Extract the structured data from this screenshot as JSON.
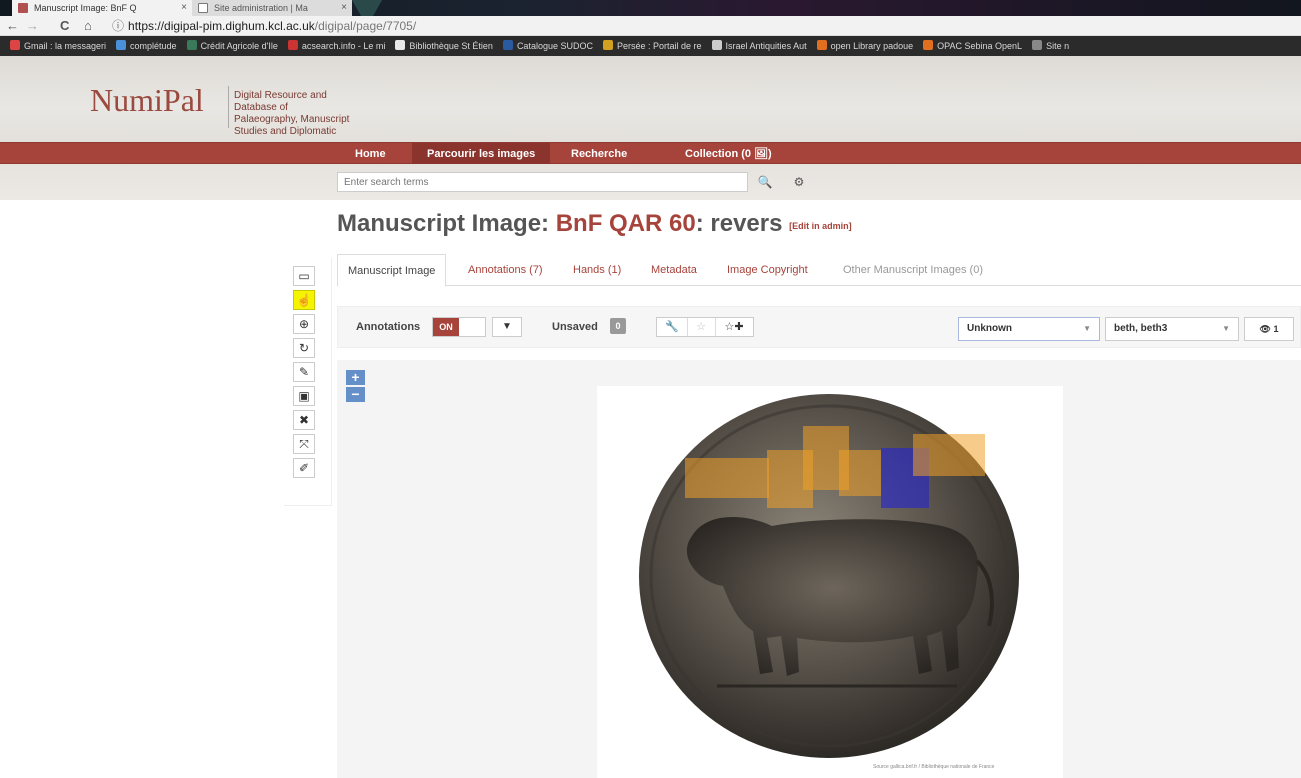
{
  "browser": {
    "tabs": [
      {
        "title": "Manuscript Image: BnF Q",
        "active": true
      },
      {
        "title": "Site administration | Ma",
        "active": false
      }
    ],
    "tab_close": "×",
    "url_host": "https://digipal-pim.dighum.kcl.ac.uk",
    "url_path": "/digipal/page/7705/",
    "nav_back": "←",
    "nav_forward": "→",
    "nav_reload": "C",
    "nav_home": "⌂",
    "info_icon": "ⓘ",
    "bookmarks": [
      {
        "label": "Gmail : la messageri",
        "color": "#d44"
      },
      {
        "label": "complétude",
        "color": "#4a90d9"
      },
      {
        "label": "Crédit Agricole d'Ile",
        "color": "#3a7a5a"
      },
      {
        "label": "acsearch.info - Le mi",
        "color": "#c33"
      },
      {
        "label": "Bibliothèque St Étien",
        "color": "#e8e8e8"
      },
      {
        "label": "Catalogue SUDOC",
        "color": "#2a5aa0"
      },
      {
        "label": "Persée : Portail de re",
        "color": "#d0a020"
      },
      {
        "label": "Israel Antiquities Aut",
        "color": "#ccc"
      },
      {
        "label": "open Library padoue",
        "color": "#e07020"
      },
      {
        "label": "OPAC Sebina OpenL",
        "color": "#e07020"
      },
      {
        "label": "Site n",
        "color": "#888"
      }
    ]
  },
  "site": {
    "logo": "NumiPal",
    "tagline": "Digital Resource and Database of Palaeography, Manuscript Studies and Diplomatic",
    "accent": "#a6433b",
    "nav": [
      {
        "label": "Home",
        "active": false
      },
      {
        "label": "Parcourir les images",
        "active": true
      },
      {
        "label": "Recherche",
        "active": false
      },
      {
        "label": "Collection (0 🖼)",
        "active": false
      }
    ],
    "search_placeholder": "Enter search terms",
    "search_icon": "🔍",
    "gear_icon": "⚙"
  },
  "page": {
    "title_prefix": "Manuscript Image: ",
    "title_ms": "BnF QAR 60",
    "title_suffix": ": revers",
    "edit_link": "[Edit in admin]"
  },
  "tabs": [
    {
      "label": "Manuscript Image",
      "state": "active"
    },
    {
      "label": "Annotations (7)",
      "state": "normal"
    },
    {
      "label": "Hands (1)",
      "state": "normal"
    },
    {
      "label": "Metadata",
      "state": "normal"
    },
    {
      "label": "Image Copyright",
      "state": "normal"
    },
    {
      "label": "Other Manuscript Images (0)",
      "state": "disabled"
    }
  ],
  "toolbar": {
    "annotations_label": "Annotations",
    "toggle_on": "ON",
    "filter_icon": "▼",
    "unsaved_label": "Unsaved",
    "unsaved_count": "0",
    "wrench_icon": "🔧",
    "star_icon": "☆",
    "star_add_icon": "☆✚",
    "allograph_select": "Unknown",
    "letters_select": "beth, beth3",
    "caret": "▼",
    "eye_count": "👁 1"
  },
  "tools": [
    {
      "name": "monitor-icon",
      "glyph": "▭",
      "selected": false
    },
    {
      "name": "hand-pointer-icon",
      "glyph": "☝",
      "selected": true
    },
    {
      "name": "zoom-in-icon",
      "glyph": "⊕",
      "selected": false
    },
    {
      "name": "refresh-icon",
      "glyph": "↻",
      "selected": false
    },
    {
      "name": "pencil-icon",
      "glyph": "✎",
      "selected": false
    },
    {
      "name": "save-icon",
      "glyph": "▣",
      "selected": false
    },
    {
      "name": "close-icon",
      "glyph": "✖",
      "selected": false
    },
    {
      "name": "expand-icon",
      "glyph": "⤧",
      "selected": false
    },
    {
      "name": "edit-icon",
      "glyph": "✐",
      "selected": false
    }
  ],
  "viewer": {
    "zoom_in": "+",
    "zoom_out": "−",
    "credit": "Source gallica.bnf.fr / Bibliothèque nationale de France",
    "annotation_colors": {
      "selected": "#f0a028",
      "active": "#2828c8"
    }
  }
}
